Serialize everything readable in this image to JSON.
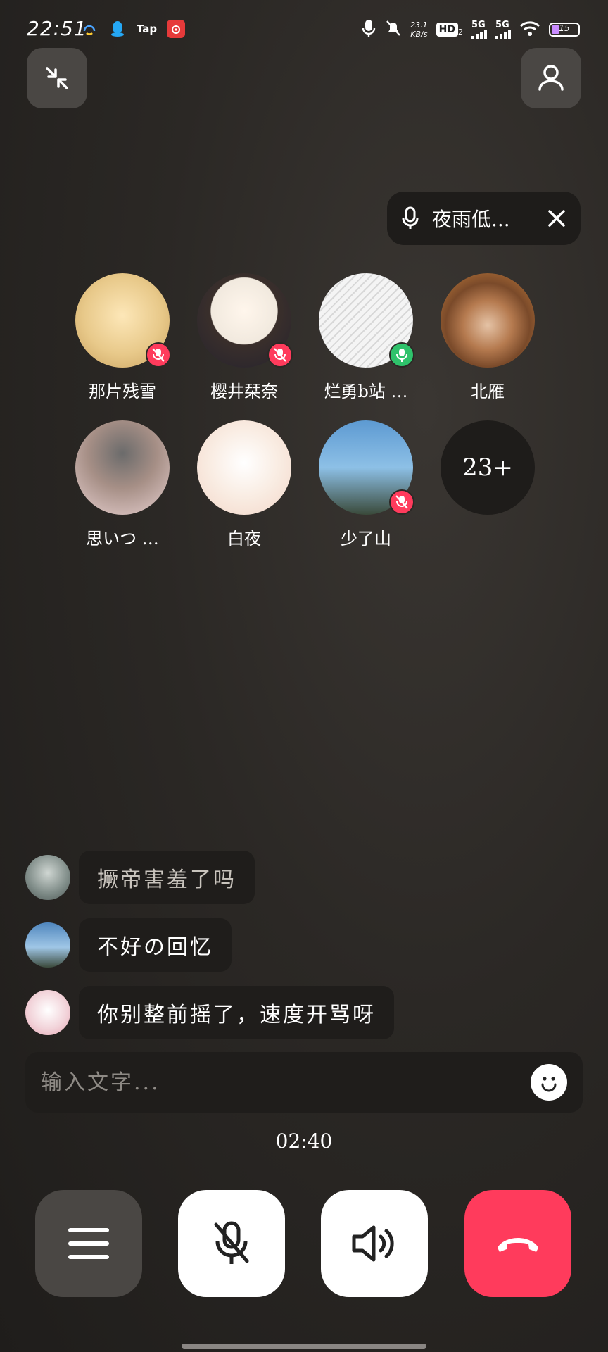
{
  "status_bar": {
    "time": "22:51",
    "net_speed_value": "23.1",
    "net_speed_unit": "KB/s",
    "hd_label": "HD",
    "hd_sub": "2",
    "sim1": "5G",
    "sim2": "5G",
    "battery": "15",
    "left_app_icons": [
      "headset-app-icon",
      "qq-icon",
      "taptap-icon",
      "netease-music-icon"
    ],
    "tap_label": "Tap"
  },
  "active_speaker": {
    "name": "夜雨低..."
  },
  "members": [
    {
      "name": "那片残雪",
      "mic": "muted",
      "avatar_color": "#e8c98a"
    },
    {
      "name": "樱井栞奈",
      "mic": "muted",
      "avatar_color": "#f1e9de"
    },
    {
      "name": "烂勇b站 …",
      "mic": "on",
      "avatar_color": "#e9e9e9"
    },
    {
      "name": "北雁",
      "mic": "none",
      "avatar_color": "#7a4a2a"
    },
    {
      "name": "思いつ …",
      "mic": "none",
      "avatar_color": "#a68f86"
    },
    {
      "name": "白夜",
      "mic": "none",
      "avatar_color": "#f3d6c8"
    },
    {
      "name": "少了山",
      "mic": "muted",
      "avatar_color": "#5d9ad2"
    }
  ],
  "more_count": "23+",
  "messages": [
    {
      "text": "撅帝害羞了吗",
      "faded": true,
      "avatar_color": "#7d8a86"
    },
    {
      "text": "不好の回忆",
      "faded": false,
      "avatar_color": "#4f86bd"
    },
    {
      "text": "你别整前摇了，速度开骂呀",
      "faded": false,
      "avatar_color": "#f2d4da"
    }
  ],
  "input": {
    "placeholder": "输入文字..."
  },
  "call_timer": "02:40",
  "colors": {
    "muted_badge": "#ff3b5c",
    "mic_on_badge": "#2fc26b",
    "hangup": "#ff3b5c"
  }
}
